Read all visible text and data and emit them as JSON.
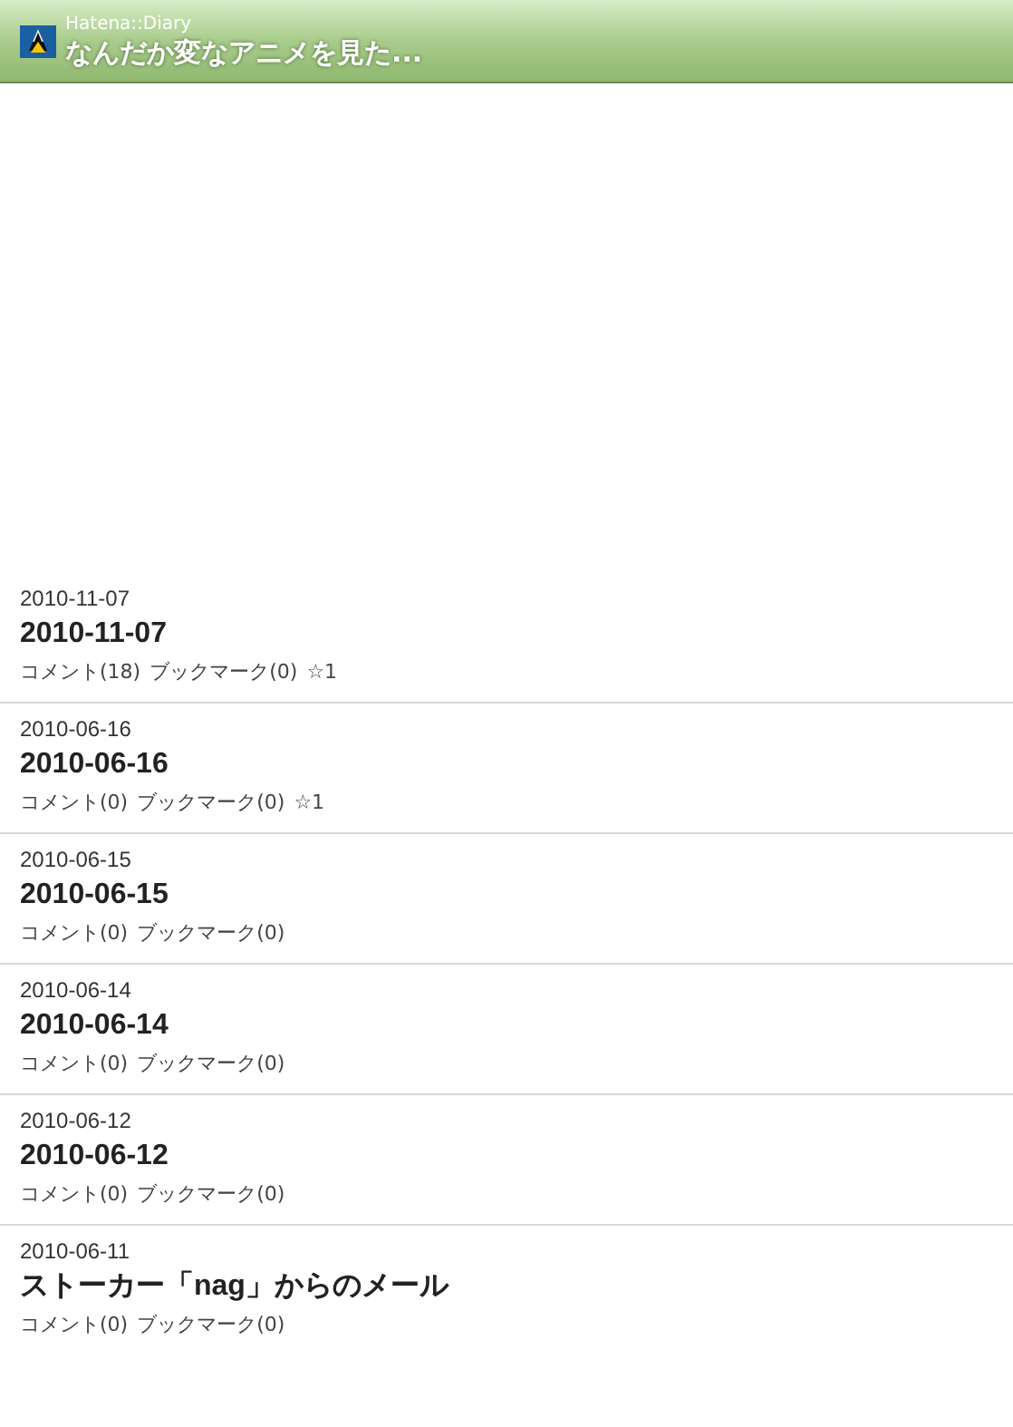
{
  "header": {
    "site": "Hatena::Diary",
    "title": "なんだか変なアニメを見た..."
  },
  "entries": [
    {
      "date": "2010-11-07",
      "title": "2010-11-07",
      "comments": "コメント(18)",
      "bookmarks": "ブックマーク(0)",
      "stars": "☆1"
    },
    {
      "date": "2010-06-16",
      "title": "2010-06-16",
      "comments": "コメント(0)",
      "bookmarks": "ブックマーク(0)",
      "stars": "☆1"
    },
    {
      "date": "2010-06-15",
      "title": "2010-06-15",
      "comments": "コメント(0)",
      "bookmarks": "ブックマーク(0)"
    },
    {
      "date": "2010-06-14",
      "title": "2010-06-14",
      "comments": "コメント(0)",
      "bookmarks": "ブックマーク(0)"
    },
    {
      "date": "2010-06-12",
      "title": "2010-06-12",
      "comments": "コメント(0)",
      "bookmarks": "ブックマーク(0)"
    },
    {
      "date": "2010-06-11",
      "title": "ストーカー「nag」からのメール",
      "comments": "コメント(0)",
      "bookmarks": "ブックマーク(0)"
    }
  ]
}
